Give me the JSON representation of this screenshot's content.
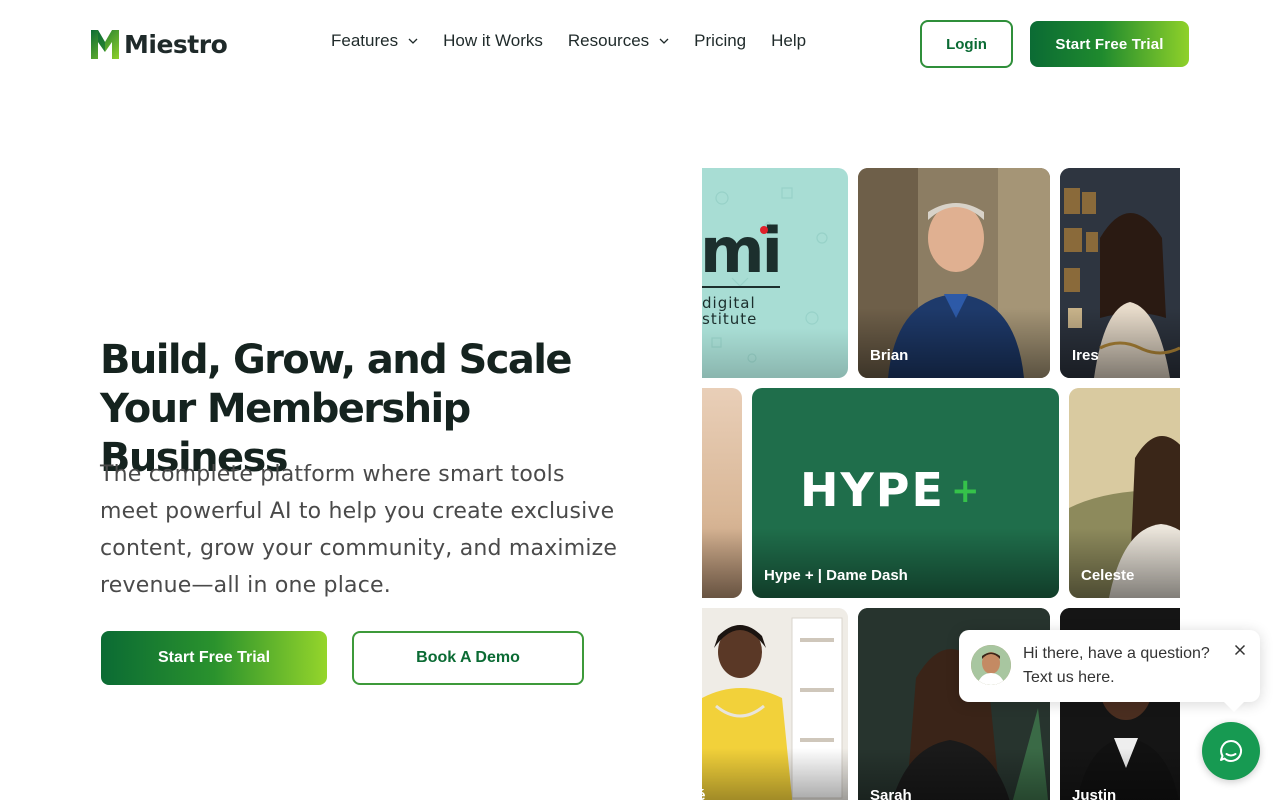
{
  "header": {
    "logo_text": "Miestro",
    "nav": [
      {
        "label": "Features",
        "has_dropdown": true
      },
      {
        "label": "How it Works",
        "has_dropdown": false
      },
      {
        "label": "Resources",
        "has_dropdown": true
      },
      {
        "label": "Pricing",
        "has_dropdown": false
      },
      {
        "label": "Help",
        "has_dropdown": false
      }
    ],
    "login_label": "Login",
    "trial_label": "Start Free Trial"
  },
  "hero": {
    "title": "Build, Grow, and Scale Your Membership Business",
    "subtitle": "The complete platform where smart tools meet powerful AI to help you create exclusive content, grow your community, and maximize revenue—all in one place.",
    "primary_cta": "Start Free Trial",
    "secondary_cta": "Book A Demo"
  },
  "gallery": {
    "cards": [
      {
        "name": "",
        "logo_lines": [
          "mi",
          "digital",
          "stitute"
        ]
      },
      {
        "name": "Brian"
      },
      {
        "name": "Ires"
      },
      {
        "name": ""
      },
      {
        "name": "Hype + | Dame Dash",
        "logo_text": "HYPE",
        "logo_plus": "+"
      },
      {
        "name": "Celeste"
      },
      {
        "name": "dé"
      },
      {
        "name": "Sarah"
      },
      {
        "name": "Justin"
      }
    ]
  },
  "chat": {
    "message": "Hi there, have a question? Text us here.",
    "close_icon": "close-icon",
    "launcher_icon": "chat-icon"
  },
  "colors": {
    "brand_dark": "#0b6b34",
    "brand_light": "#8fd12a",
    "hype_bg": "#1f6e4b",
    "chat_fab": "#179a52"
  }
}
